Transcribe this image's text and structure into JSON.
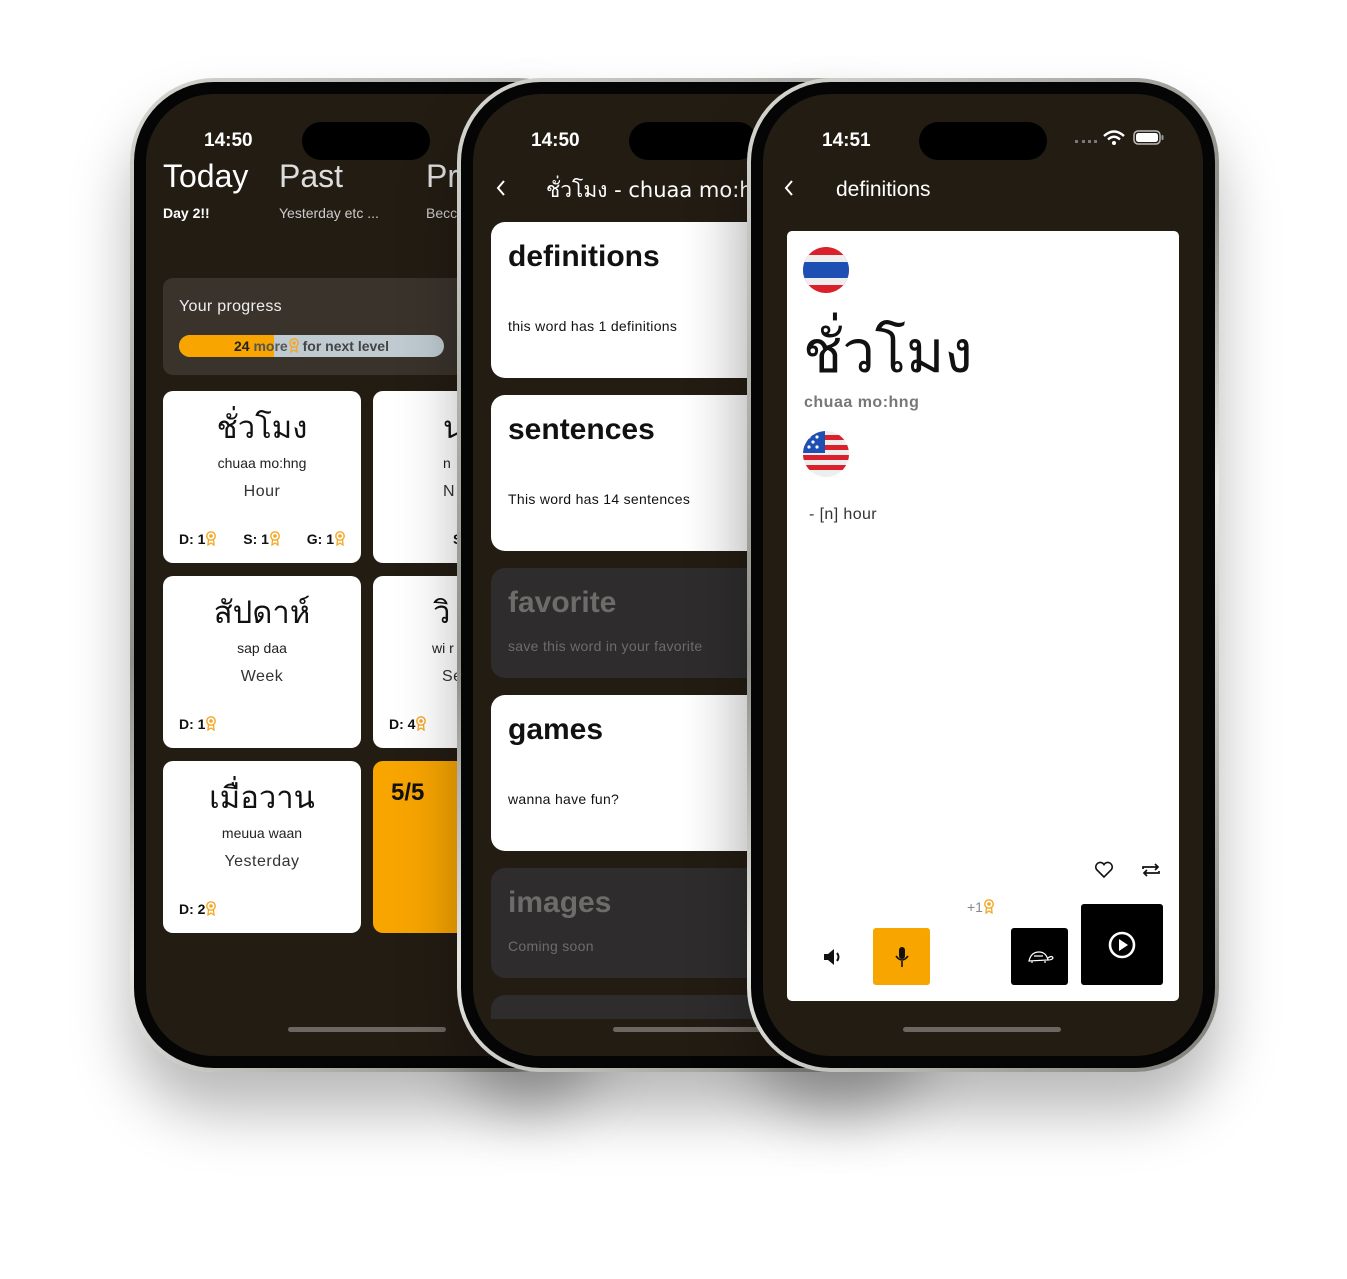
{
  "colors": {
    "accent": "#f8a500",
    "screen_bg": "#231c13",
    "card": "#ffffff",
    "disabled_card": "#2e2c2c"
  },
  "phone1": {
    "time": "14:50",
    "tabs": [
      {
        "label": "Today",
        "sub": "Day 2!!"
      },
      {
        "label": "Past",
        "sub": "Yesterday etc ..."
      },
      {
        "label": "Pr",
        "sub": "Becc"
      }
    ],
    "progress": {
      "title": "Your progress",
      "count": "24",
      "text_more": "more",
      "text_rest": "for next level",
      "fill_percent": 36
    },
    "cards": [
      {
        "thai": "ชั่วโมง",
        "roman": "chuaa mo:hng",
        "english": "Hour",
        "stats": [
          "D: 1",
          "S: 1",
          "G: 1"
        ]
      },
      {
        "thai": "น",
        "roman": "n",
        "english": "N",
        "stats": [
          "S"
        ]
      },
      {
        "thai": "สัปดาห์",
        "roman": "sap daa",
        "english": "Week",
        "stats": [
          "D: 1"
        ]
      },
      {
        "thai": "วิ",
        "roman": "wi r",
        "english": "Se",
        "stats": [
          "D: 4"
        ]
      },
      {
        "thai": "เมื่อวาน",
        "roman": "meuua waan",
        "english": "Yesterday",
        "stats": [
          "D: 2"
        ]
      }
    ],
    "score_card": "5/5"
  },
  "phone2": {
    "time": "14:50",
    "title": "ชั่วโมง - chuaa mo:hng",
    "menu": [
      {
        "title": "definitions",
        "sub": "this word has 1 definitions",
        "enabled": true
      },
      {
        "title": "sentences",
        "sub": "This word has 14 sentences",
        "enabled": true
      },
      {
        "title": "favorite",
        "sub": "save this word in your favorite",
        "enabled": false
      },
      {
        "title": "games",
        "sub": "wanna have fun?",
        "enabled": true
      },
      {
        "title": "images",
        "sub": "Coming soon",
        "enabled": false
      }
    ]
  },
  "phone3": {
    "time": "14:51",
    "title": "definitions",
    "thai": "ชั่วโมง",
    "roman": "chuaa mo:hng",
    "definition": "- [n] hour",
    "reward": "+1",
    "icons": [
      "back-icon",
      "thai-flag-icon",
      "us-flag-icon",
      "heart-icon",
      "repeat-icon",
      "speaker-icon",
      "microphone-icon",
      "turtle-icon",
      "play-icon",
      "wifi-icon",
      "battery-icon"
    ]
  }
}
